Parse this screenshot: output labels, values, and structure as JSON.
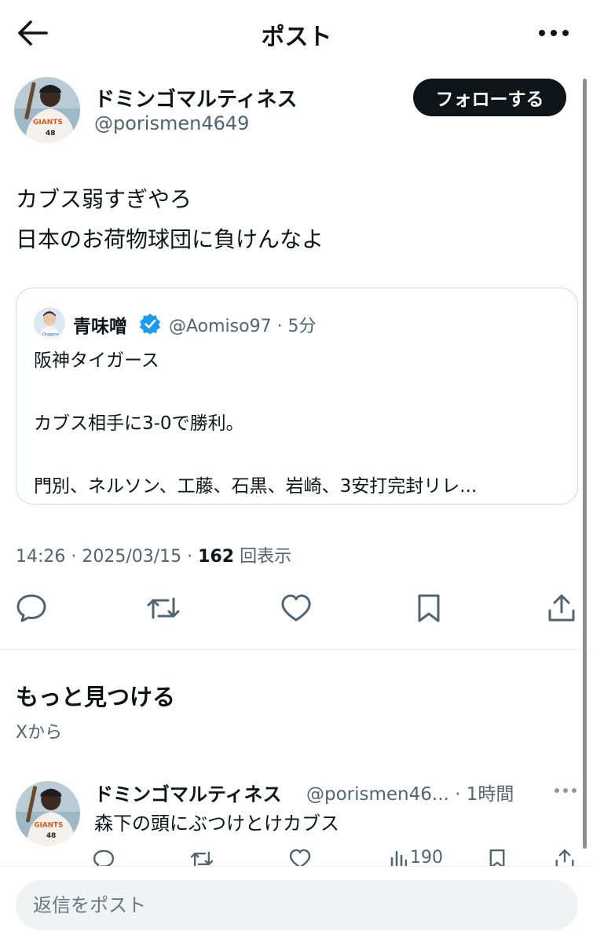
{
  "header": {
    "title": "ポスト"
  },
  "post": {
    "author_name": "ドミンゴマルティネス",
    "author_handle": "@porismen4649",
    "follow_label": "フォローする",
    "text_line1": "カブス弱すぎやろ",
    "text_line2": "日本のお荷物球団に負けんなよ",
    "quote": {
      "name": "青味噌",
      "handle_time": "@Aomiso97 · 5分",
      "line1": "阪神タイガース",
      "line2": "カブス相手に3-0で勝利。",
      "line3": "門別、ネルソン、工藤、石黒、岩崎、3安打完封リレ..."
    },
    "timestamp": "14:26 · 2025/03/15 · ",
    "views_count": "162",
    "views_label": " 回表示"
  },
  "discover": {
    "title": "もっと見つける",
    "subtitle": "Xから",
    "item": {
      "name": "ドミンゴマルティネス",
      "handle_time": "@porismen46... · 1時間",
      "text": "森下の頭にぶつけとけカブス",
      "views": "190"
    }
  },
  "reply": {
    "placeholder": "返信をポスト"
  },
  "colors": {
    "text": "#0f1419",
    "secondary": "#536471",
    "verified": "#1d9bf0",
    "follow_bg": "#0f1419"
  },
  "icons": [
    "back-arrow-icon",
    "more-icon",
    "verified-icon",
    "reply-icon",
    "repost-icon",
    "like-icon",
    "bookmark-icon",
    "share-icon",
    "views-icon"
  ]
}
